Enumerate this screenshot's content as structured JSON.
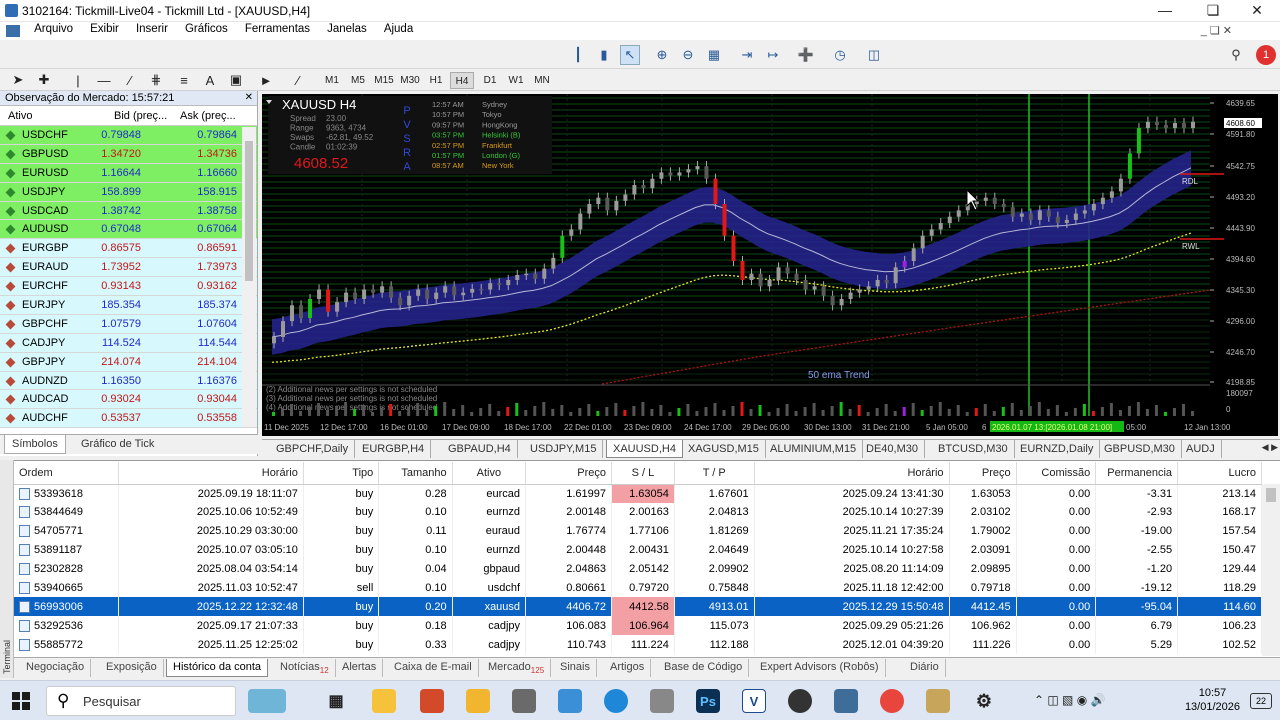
{
  "window": {
    "title": "3102164: Tickmill-Live04 - Tickmill Ltd - [XAUUSD,H4]"
  },
  "menu": [
    "Arquivo",
    "Exibir",
    "Inserir",
    "Gráficos",
    "Ferramentas",
    "Janelas",
    "Ajuda"
  ],
  "timeframes": [
    "M1",
    "M5",
    "M15",
    "M30",
    "H1",
    "H4",
    "D1",
    "W1",
    "MN"
  ],
  "active_timeframe": "H4",
  "market_watch": {
    "header": "Observação do Mercado: 15:57:21",
    "cols": [
      "Ativo",
      "Bid (preç...",
      "Ask (preç..."
    ],
    "rows": [
      {
        "sym": "USDCHF",
        "bid": "0.79848",
        "ask": "0.79864",
        "state": "up"
      },
      {
        "sym": "GBPUSD",
        "bid": "1.34720",
        "ask": "1.34736",
        "state": "up"
      },
      {
        "sym": "EURUSD",
        "bid": "1.16644",
        "ask": "1.16660",
        "state": "up"
      },
      {
        "sym": "USDJPY",
        "bid": "158.899",
        "ask": "158.915",
        "state": "up"
      },
      {
        "sym": "USDCAD",
        "bid": "1.38742",
        "ask": "1.38758",
        "state": "up"
      },
      {
        "sym": "AUDUSD",
        "bid": "0.67048",
        "ask": "0.67064",
        "state": "up"
      },
      {
        "sym": "EURGBP",
        "bid": "0.86575",
        "ask": "0.86591",
        "state": "dn"
      },
      {
        "sym": "EURAUD",
        "bid": "1.73952",
        "ask": "1.73973",
        "state": "dn"
      },
      {
        "sym": "EURCHF",
        "bid": "0.93143",
        "ask": "0.93162",
        "state": "dn"
      },
      {
        "sym": "EURJPY",
        "bid": "185.354",
        "ask": "185.374",
        "state": "dnb"
      },
      {
        "sym": "GBPCHF",
        "bid": "1.07579",
        "ask": "1.07604",
        "state": "dnb"
      },
      {
        "sym": "CADJPY",
        "bid": "114.524",
        "ask": "114.544",
        "state": "dnb"
      },
      {
        "sym": "GBPJPY",
        "bid": "214.074",
        "ask": "214.104",
        "state": "dn"
      },
      {
        "sym": "AUDNZD",
        "bid": "1.16350",
        "ask": "1.16376",
        "state": "dnb"
      },
      {
        "sym": "AUDCAD",
        "bid": "0.93024",
        "ask": "0.93044",
        "state": "dn"
      },
      {
        "sym": "AUDCHF",
        "bid": "0.53537",
        "ask": "0.53558",
        "state": "dn"
      }
    ],
    "tabs": [
      "Símbolos",
      "Gráfico de Tick"
    ]
  },
  "chart": {
    "symbol": "XAUUSD  H4",
    "info_labels": [
      "Spread",
      "Range",
      "Swaps",
      "Candle"
    ],
    "info_values": [
      "23.00",
      "9363, 4734",
      "-62.81, 49.52",
      "01:02:39"
    ],
    "price": "4608.52",
    "pvsra": "PVSRA",
    "sessions": [
      {
        "t": "12:57 AM",
        "n": "Sydney",
        "c": "#9a9a9a"
      },
      {
        "t": "10:57 PM",
        "n": "Tokyo",
        "c": "#9a9a9a"
      },
      {
        "t": "09:57 PM",
        "n": "HongKong",
        "c": "#9a9a9a"
      },
      {
        "t": "03:57 PM",
        "n": "Helsinki (B)",
        "c": "#36c838"
      },
      {
        "t": "02:57 PM",
        "n": "Frankfurt",
        "c": "#d89a18"
      },
      {
        "t": "01:57 PM",
        "n": "London (G)",
        "c": "#36c838"
      },
      {
        "t": "08:57 AM",
        "n": "New York",
        "c": "#d89a18"
      }
    ],
    "y_ticks": [
      "4639.65",
      "4591.80",
      "4542.75",
      "4493.20",
      "4443.90",
      "4394.60",
      "4345.30",
      "4296.00",
      "4246.70",
      "4198.85"
    ],
    "price_tag": "4608.60",
    "vol_ticks": [
      "180097",
      "0"
    ],
    "x_ticks": [
      "11 Dec 2025",
      "12 Dec 17:00",
      "16 Dec 01:00",
      "17 Dec 09:00",
      "18 Dec 17:00",
      "22 Dec 01:00",
      "23 Dec 09:00",
      "24 Dec 17:00",
      "29 Dec 05:00",
      "30 Dec 13:00",
      "31 Dec 21:00",
      "5 Jan 05:00",
      "6",
      "05:00",
      "12 Jan 13:00"
    ],
    "x_highlight": "2026.01.07 13:[2026.01.08 21:00]",
    "rdl": "RDL",
    "rwl": "RWL",
    "trend_label": "50 ema Trend",
    "news": [
      "(2) Additional news per settings is not scheduled",
      "(3) Additional news per settings is not scheduled",
      "(4) Additional news per settings is not scheduled"
    ]
  },
  "chart_tabs": [
    "GBPCHF,Daily",
    "EURGBP,H4",
    "GBPAUD,H4",
    "USDJPY,M15",
    "XAUUSD,H4",
    "XAGUSD,M15",
    "ALUMINIUM,M15",
    "DE40,M30",
    "BTCUSD,M30",
    "EURNZD,Daily",
    "GBPUSD,M30",
    "AUDJ"
  ],
  "active_chart_tab": "XAUUSD,H4",
  "orders": {
    "cols": [
      "Ordem",
      "Horário",
      "Tipo",
      "Tamanho",
      "Ativo",
      "Preço",
      "S / L",
      "T / P",
      "Horário",
      "Preço",
      "Comissão",
      "Permanencia",
      "Lucro"
    ],
    "rows": [
      [
        "53393618",
        "2025.09.19 18:11:07",
        "buy",
        "0.28",
        "eurcad",
        "1.61997",
        "1.63054",
        "1.67601",
        "2025.09.24 13:41:30",
        "1.63053",
        "0.00",
        "-3.31",
        "213.14"
      ],
      [
        "53844649",
        "2025.10.06 10:52:49",
        "buy",
        "0.10",
        "eurnzd",
        "2.00148",
        "2.00163",
        "2.04813",
        "2025.10.14 10:27:39",
        "2.03102",
        "0.00",
        "-2.93",
        "168.17"
      ],
      [
        "54705771",
        "2025.10.29 03:30:00",
        "buy",
        "0.11",
        "euraud",
        "1.76774",
        "1.77106",
        "1.81269",
        "2025.11.21 17:35:24",
        "1.79002",
        "0.00",
        "-19.00",
        "157.54"
      ],
      [
        "53891187",
        "2025.10.07 03:05:10",
        "buy",
        "0.10",
        "eurnzd",
        "2.00448",
        "2.00431",
        "2.04649",
        "2025.10.14 10:27:58",
        "2.03091",
        "0.00",
        "-2.55",
        "150.47"
      ],
      [
        "52302828",
        "2025.08.04 03:54:14",
        "buy",
        "0.04",
        "gbpaud",
        "2.04863",
        "2.05142",
        "2.09902",
        "2025.08.20 11:14:09",
        "2.09895",
        "0.00",
        "-1.20",
        "129.44"
      ],
      [
        "53940665",
        "2025.11.03 10:52:47",
        "sell",
        "0.10",
        "usdchf",
        "0.80661",
        "0.79720",
        "0.75848",
        "2025.11.18 12:42:00",
        "0.79718",
        "0.00",
        "-19.12",
        "118.29"
      ],
      [
        "56993006",
        "2025.12.22 12:32:48",
        "buy",
        "0.20",
        "xauusd",
        "4406.72",
        "4412.58",
        "4913.01",
        "2025.12.29 15:50:48",
        "4412.45",
        "0.00",
        "-95.04",
        "114.60"
      ],
      [
        "53292536",
        "2025.09.17 21:07:33",
        "buy",
        "0.18",
        "cadjpy",
        "106.083",
        "106.964",
        "115.073",
        "2025.09.29 05:21:26",
        "106.962",
        "0.00",
        "6.79",
        "106.23"
      ],
      [
        "55885772",
        "2025.11.25 12:25:02",
        "buy",
        "0.33",
        "cadjpy",
        "110.743",
        "111.224",
        "112.188",
        "2025.12.01 04:39:20",
        "111.226",
        "0.00",
        "5.29",
        "102.52"
      ]
    ],
    "highlight_sl": [
      0,
      6,
      7
    ],
    "selected": 6
  },
  "term_side": "Terminal",
  "term_tabs": [
    {
      "label": "Negociação",
      "badge": ""
    },
    {
      "label": "Exposição",
      "badge": ""
    },
    {
      "label": "Histórico da conta",
      "badge": ""
    },
    {
      "label": "Notícias",
      "badge": "12"
    },
    {
      "label": "Alertas",
      "badge": ""
    },
    {
      "label": "Caixa de E-mail",
      "badge": ""
    },
    {
      "label": "Mercado",
      "badge": "125"
    },
    {
      "label": "Sinais",
      "badge": ""
    },
    {
      "label": "Artigos",
      "badge": ""
    },
    {
      "label": "Base de Código",
      "badge": ""
    },
    {
      "label": "Expert Advisors (Robôs)",
      "badge": ""
    },
    {
      "label": "Diário",
      "badge": ""
    }
  ],
  "active_term_tab": "Histórico da conta",
  "taskbar": {
    "search": "Pesquisar",
    "time": "10:57",
    "date": "13/01/2026",
    "notif": "22"
  },
  "colors": {
    "up_row": "#7eef62",
    "dn_row": "#d7f8fc",
    "selected_row": "#0a63c4",
    "sl_highlight": "#f2a0a4"
  }
}
